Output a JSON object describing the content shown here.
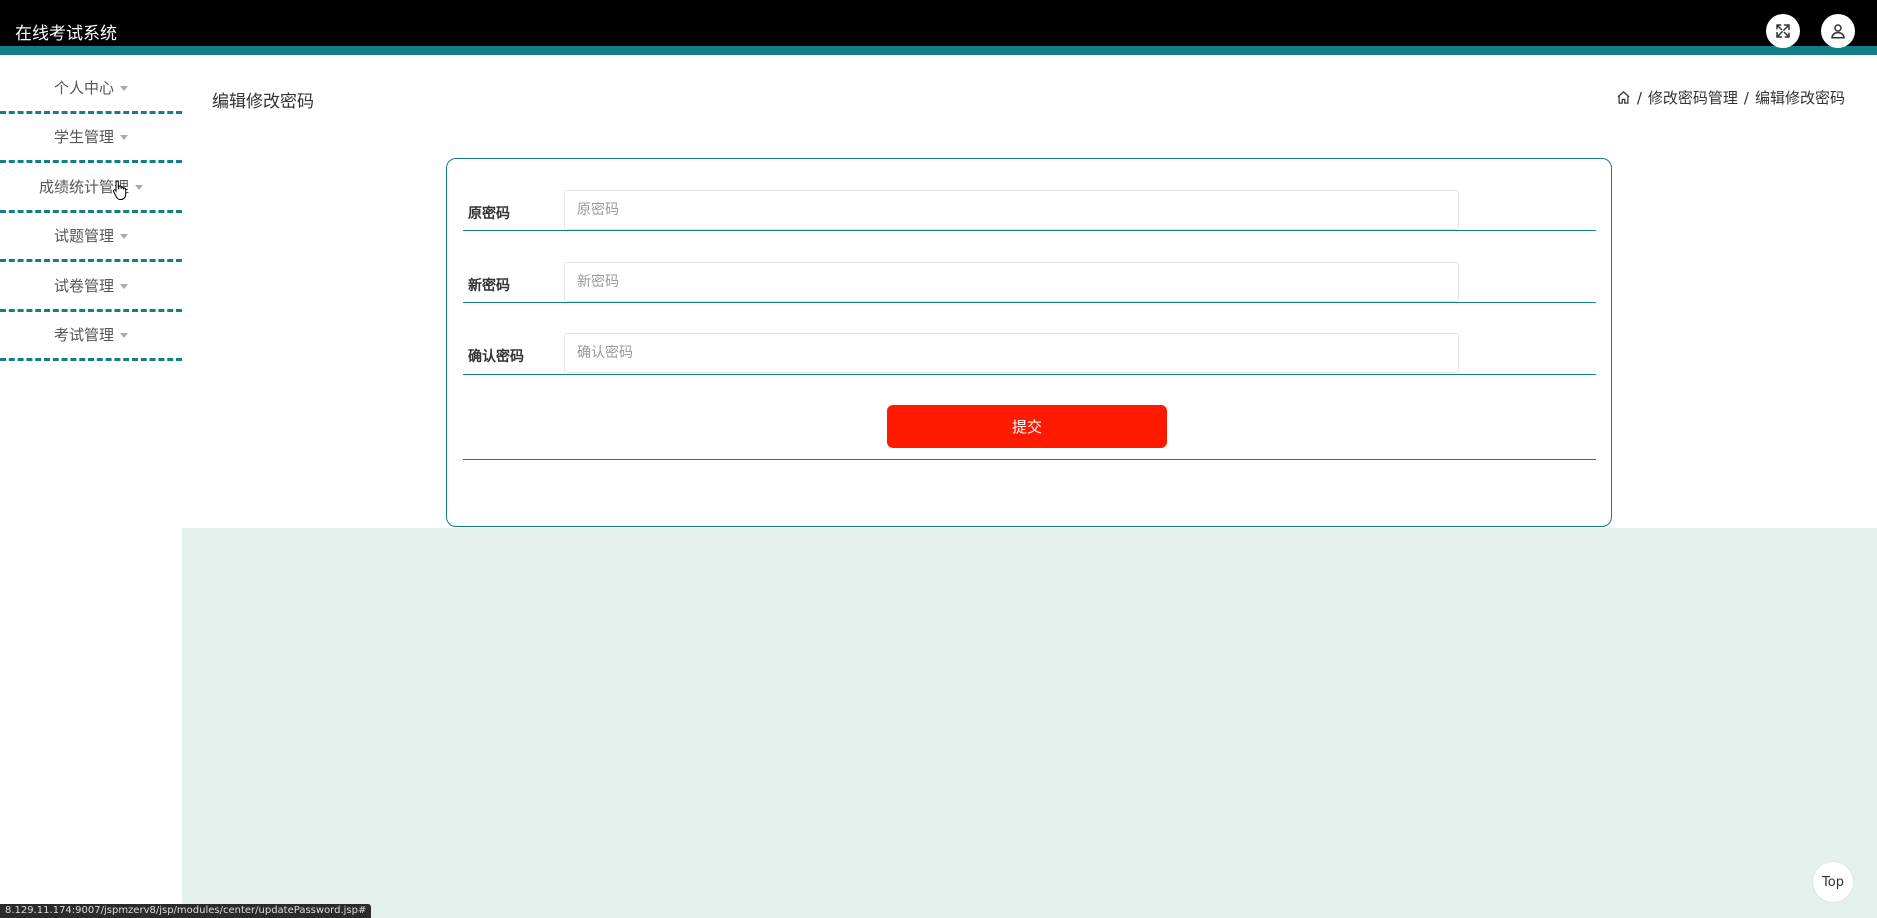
{
  "app": {
    "title": "在线考试系统"
  },
  "header": {
    "fullscreen_icon": "expand-arrows-icon",
    "user_icon": "user-icon"
  },
  "sidebar": {
    "items": [
      {
        "label": "个人中心"
      },
      {
        "label": "学生管理"
      },
      {
        "label": "成绩统计管理"
      },
      {
        "label": "试题管理"
      },
      {
        "label": "试卷管理"
      },
      {
        "label": "考试管理"
      }
    ]
  },
  "page": {
    "title": "编辑修改密码",
    "breadcrumb": {
      "home_icon": "home-icon",
      "separator": "/",
      "items": [
        "修改密码管理",
        "编辑修改密码"
      ]
    }
  },
  "form": {
    "fields": [
      {
        "label": "原密码",
        "placeholder": "原密码",
        "value": ""
      },
      {
        "label": "新密码",
        "placeholder": "新密码",
        "value": ""
      },
      {
        "label": "确认密码",
        "placeholder": "确认密码",
        "value": ""
      }
    ],
    "submit_label": "提交"
  },
  "back_to_top": {
    "label": "Top"
  },
  "status_bar": {
    "url": "8.129.11.174:9007/jspmzerv8/jsp/modules/center/updatePassword.jsp#"
  },
  "colors": {
    "topbar": "#000000",
    "accent": "#137f84",
    "submit": "#ff1a00",
    "content_bg": "#e3f0ec"
  }
}
